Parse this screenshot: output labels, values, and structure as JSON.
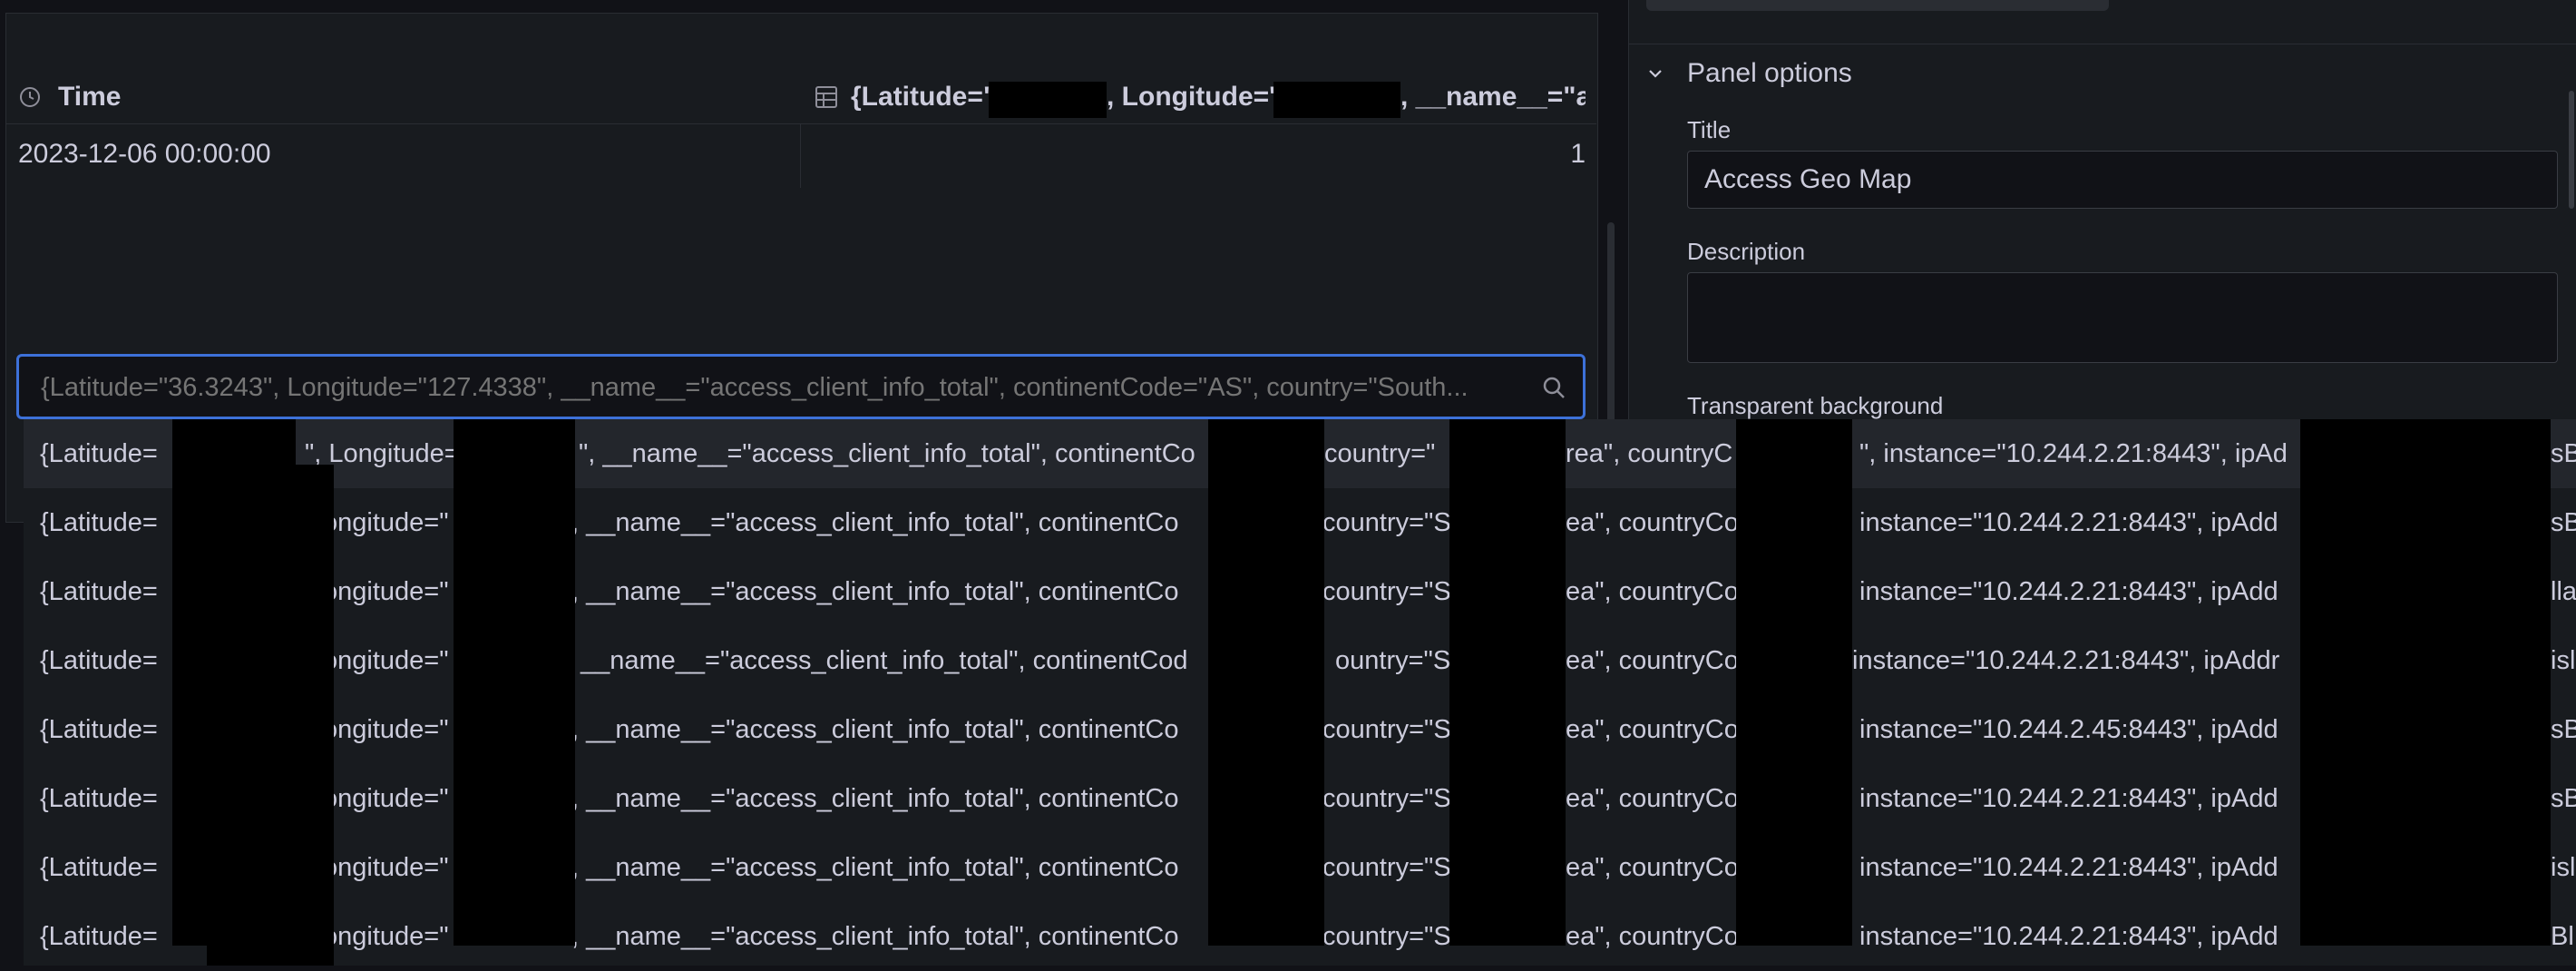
{
  "table": {
    "time_header": "Time",
    "series_header": "{Latitude=\"",
    "series_header_mid": ", Longitude='",
    "series_header_end": ", __name__=\"ac",
    "rows": [
      {
        "time": "2023-12-06 00:00:00",
        "value": "1"
      }
    ]
  },
  "search": {
    "placeholder": "{Latitude=\"36.3243\", Longitude=\"127.4338\", __name__=\"access_client_info_total\", continentCode=\"AS\", country=\"South..."
  },
  "options": [
    {
      "a": "{Latitude=",
      "b": "\", Longitude=\"",
      "c": "\", __name__=\"access_client_info_total\", continentCo",
      "d": "country=\"",
      "e": "rea\", countryC",
      "f": "\", instance=\"10.244.2.21:8443\", ipAd",
      "g": "sBl"
    },
    {
      "a": "{Latitude=",
      "b": "ongitude=\"",
      "c": ", __name__=\"access_client_info_total\", continentCo",
      "d": "country=\"S",
      "e": "ea\", countryCo",
      "f": "instance=\"10.244.2.21:8443\", ipAdd",
      "g": "sBl"
    },
    {
      "a": "{Latitude=",
      "b": "ongitude=\"",
      "c": ", __name__=\"access_client_info_total\", continentCo",
      "d": "country=\"S",
      "e": "ea\", countryCo",
      "f": "instance=\"10.244.2.21:8443\", ipAdd",
      "g": "lla"
    },
    {
      "a": "{Latitude=",
      "b": "ongitude=\"",
      "c": "__name__=\"access_client_info_total\", continentCod",
      "d": "ountry=\"S",
      "e": "ea\", countryCo",
      "f": "instance=\"10.244.2.21:8443\", ipAddr",
      "g": "isl"
    },
    {
      "a": "{Latitude=",
      "b": "ongitude=\"",
      "c": ", __name__=\"access_client_info_total\", continentCo",
      "d": "country=\"S",
      "e": "ea\", countryCo",
      "f": "instance=\"10.244.2.45:8443\", ipAdd",
      "g": "sB"
    },
    {
      "a": "{Latitude=",
      "b": "ongitude=\"",
      "c": ", __name__=\"access_client_info_total\", continentCo",
      "d": "country=\"S",
      "e": "ea\", countryCo",
      "f": "instance=\"10.244.2.21:8443\", ipAdd",
      "g": "sB"
    },
    {
      "a": "{Latitude=",
      "b": "ongitude=\"",
      "c": ", __name__=\"access_client_info_total\", continentCo",
      "d": "country=\"S",
      "e": "ea\", countryCo",
      "f": "instance=\"10.244.2.21:8443\", ipAdd",
      "g": "isl"
    },
    {
      "a": "{Latitude=",
      "b": "ongitude=\"",
      "c": ", __name__=\"access_client_info_total\", continentCo",
      "d": "country=\"S",
      "e": "ea\", countryCo",
      "f": "instance=\"10.244.2.21:8443\", ipAdd",
      "g": "Bl"
    }
  ],
  "panel_options": {
    "section_title": "Panel options",
    "title_label": "Title",
    "title_value": "Access Geo Map",
    "description_label": "Description",
    "transparent_label": "Transparent background"
  },
  "colors": {
    "accent": "#3d71d9",
    "bg": "#111217",
    "panel": "#181b1f"
  }
}
